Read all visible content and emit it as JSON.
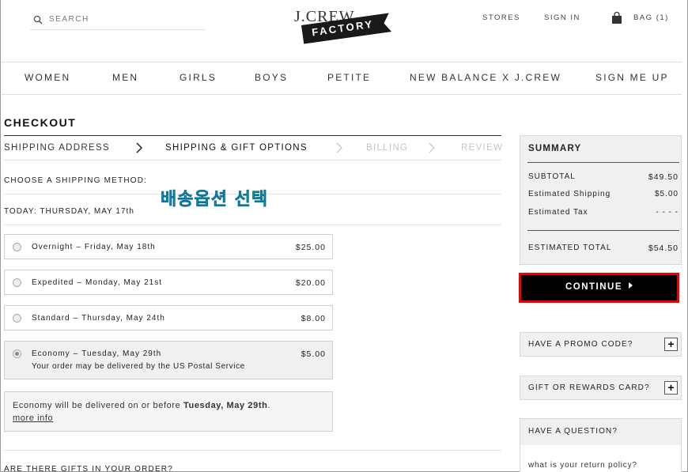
{
  "header": {
    "search_placeholder": "SEARCH",
    "logo_top": "J.CREW",
    "logo_banner": "FACTORY",
    "stores": "STORES",
    "sign_in": "SIGN IN",
    "bag": "BAG (1)"
  },
  "nav": [
    "WOMEN",
    "MEN",
    "GIRLS",
    "BOYS",
    "PETITE",
    "NEW BALANCE X J.CREW",
    "SIGN ME UP"
  ],
  "checkout": {
    "title": "CHECKOUT",
    "steps": [
      "SHIPPING ADDRESS",
      "SHIPPING & GIFT OPTIONS",
      "BILLING",
      "REVIEW"
    ],
    "choose_label": "CHOOSE A SHIPPING METHOD:",
    "today_label": "TODAY:",
    "today_value": "THURSDAY, MAY 17th",
    "annotation": "배송옵션 선택",
    "options": [
      {
        "name": "Overnight",
        "sep": "–",
        "date": "Friday, May 18th",
        "price": "$25.00"
      },
      {
        "name": "Expedited",
        "sep": "–",
        "date": "Monday, May 21st",
        "price": "$20.00"
      },
      {
        "name": "Standard",
        "sep": "–",
        "date": "Thursday, May 24th",
        "price": "$8.00"
      },
      {
        "name": "Economy",
        "sep": "–",
        "date": "Tuesday, May 29th",
        "price": "$5.00",
        "note": "Your order may be delivered by the US Postal Service"
      }
    ],
    "info_prefix": "Economy will be delivered on or before",
    "info_date": "Tuesday, May 29th",
    "info_suffix": ".",
    "more_info": "more info",
    "gifts_label": "ARE THERE GIFTS IN YOUR ORDER?"
  },
  "summary": {
    "title": "SUMMARY",
    "subtotal_label": "SUBTOTAL",
    "subtotal_value": "$49.50",
    "shipping_label": "Estimated Shipping",
    "shipping_value": "$5.00",
    "tax_label": "Estimated Tax",
    "tax_value": "- - - -",
    "total_label": "ESTIMATED TOTAL",
    "total_value": "$54.50"
  },
  "continue_label": "CONTINUE",
  "promo_label": "HAVE A PROMO CODE?",
  "gift_card_label": "GIFT OR REWARDS CARD?",
  "plus": "+",
  "question_title": "HAVE A QUESTION?",
  "question_link": "what is your return policy?"
}
